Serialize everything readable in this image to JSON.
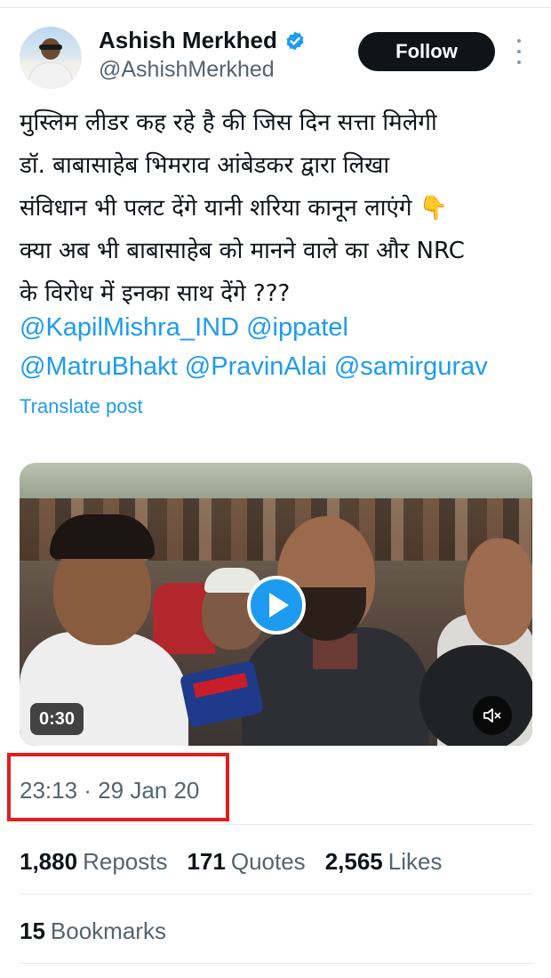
{
  "author": {
    "display_name": "Ashish Merkhed",
    "handle": "@AshishMerkhed",
    "verified_icon": "verified-badge-icon"
  },
  "follow_label": "Follow",
  "tweet": {
    "lines": [
      "मुस्लिम लीडर कह रहे है की जिस दिन सत्ता मिलेगी",
      "डॉ. बाबासाहेब भिमराव आंबेडकर द्वारा लिखा",
      "संविधान भी पलट देंगे यानी शरिया कानून लाएंगे 👇",
      "क्या अब भी बाबासाहेब को मानने वाले का और NRC",
      "के विरोध में इनका साथ देंगे ???"
    ],
    "mentions_line1": [
      "@KapilMishra_IND",
      "@ippatel"
    ],
    "mentions_line2": [
      "@MatruBhakt",
      "@PravinAlai",
      "@samirgurav"
    ]
  },
  "translate_label": "Translate post",
  "video": {
    "duration": "0:30",
    "play_icon": "play-icon",
    "mute_icon": "muted-speaker-icon"
  },
  "timestamp": "23:13 · 29 Jan 20",
  "stats": {
    "reposts_count": "1,880",
    "reposts_label": "Reposts",
    "quotes_count": "171",
    "quotes_label": "Quotes",
    "likes_count": "2,565",
    "likes_label": "Likes"
  },
  "bookmarks": {
    "count": "15",
    "label": "Bookmarks"
  },
  "colors": {
    "accent": "#1d9bf0",
    "highlight_box": "#e11d1d",
    "text_primary": "#0f1419",
    "text_secondary": "#536471"
  }
}
